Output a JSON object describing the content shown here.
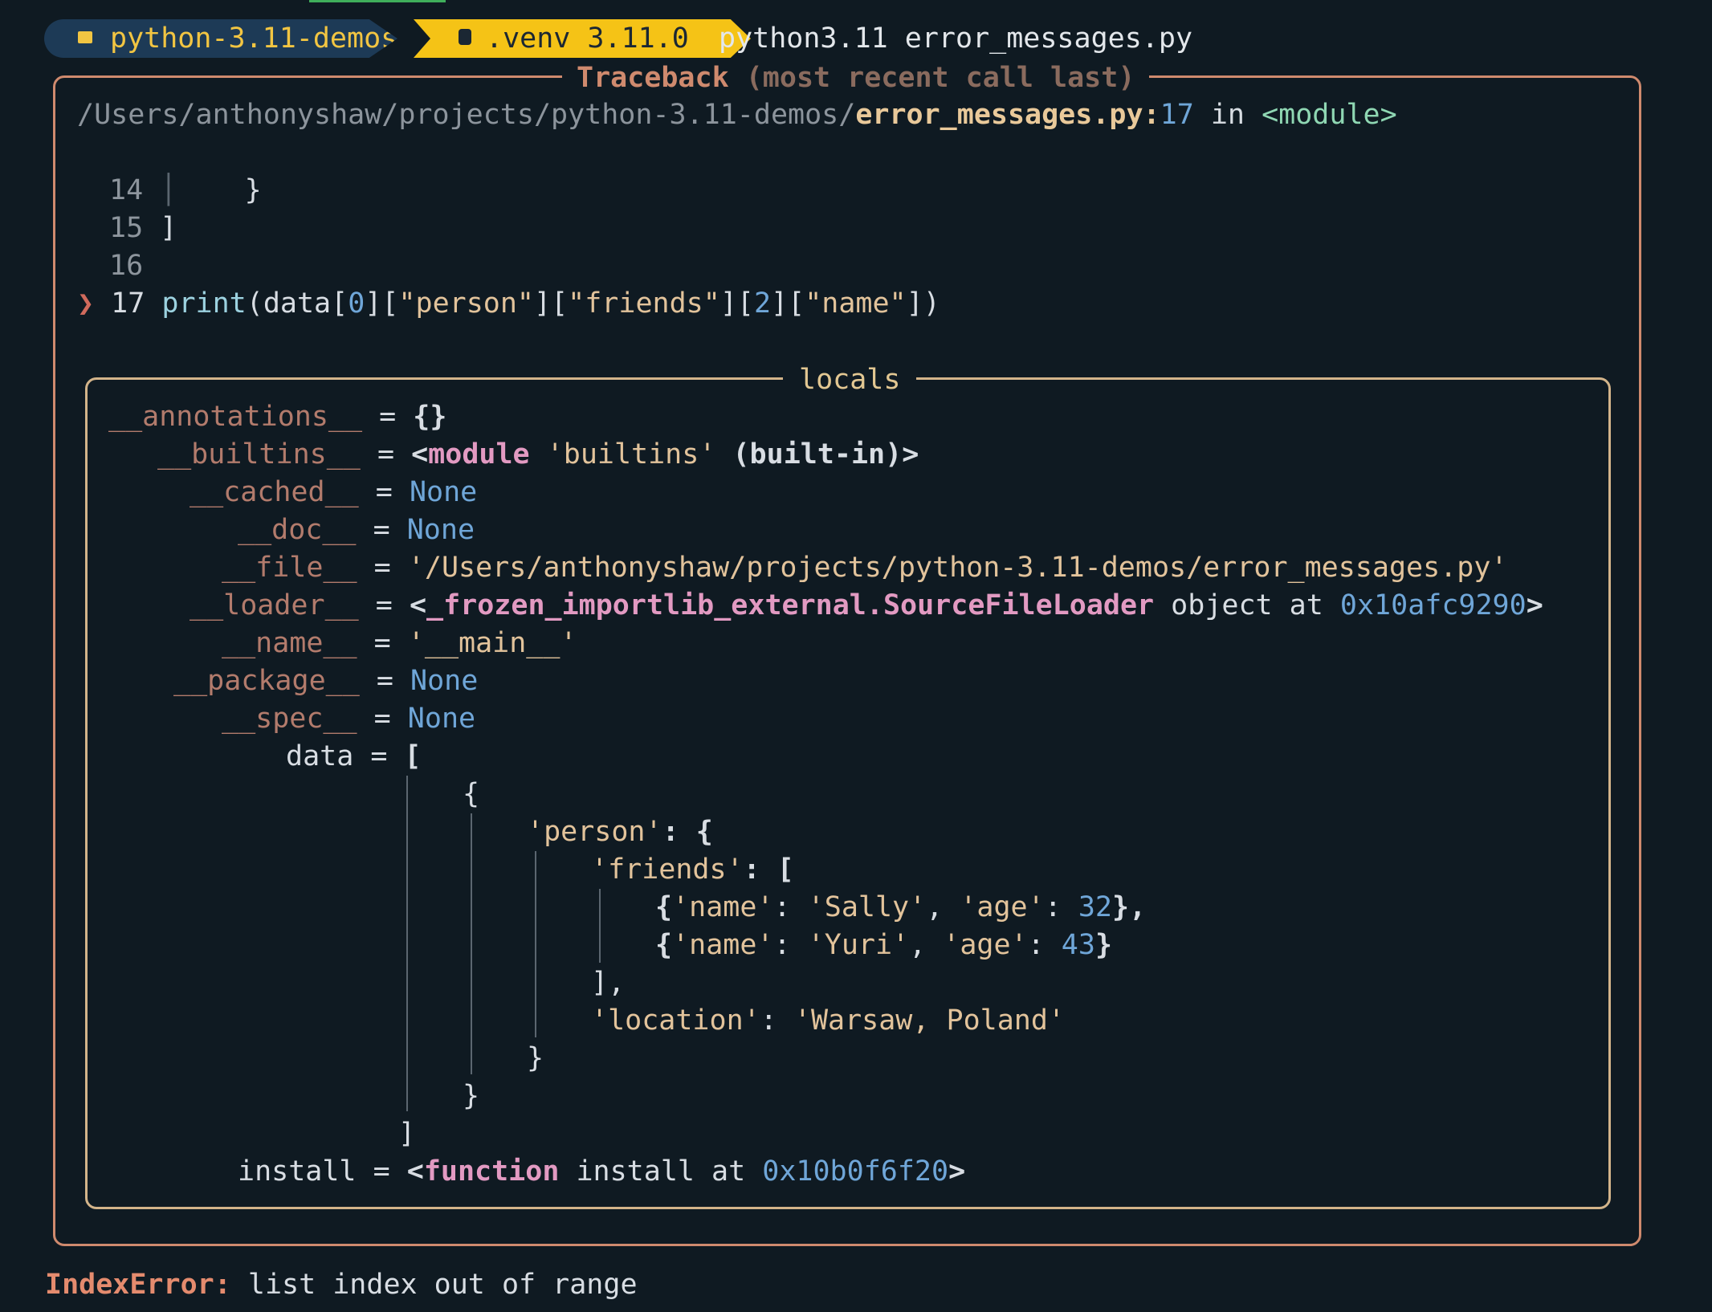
{
  "prompt": {
    "dir": "python-3.11-demos",
    "venv": ".venv 3.11.0",
    "command": "python3.11 error_messages.py"
  },
  "traceback": {
    "title": "Traceback",
    "subtitle": "(most recent call last)",
    "path_prefix": "/Users/anthonyshaw/projects/python-3.11-demos/",
    "file": "error_messages.py",
    "colon": ":",
    "line": "17",
    "in_text": " in ",
    "module": "<module>",
    "code_lines": [
      {
        "no": "14",
        "text": "    }"
      },
      {
        "no": "15",
        "text": "]"
      },
      {
        "no": "16",
        "text": ""
      }
    ],
    "current": {
      "marker": "❯",
      "no": "17",
      "func": "print",
      "parts": [
        "(data[",
        "0",
        "][",
        "\"person\"",
        "][",
        "\"friends\"",
        "][",
        "2",
        "][",
        "\"name\"",
        "])"
      ]
    }
  },
  "locals": {
    "title": "locals",
    "annotations": {
      "key": "__annotations__",
      "value": "{}"
    },
    "builtins": {
      "key": "__builtins__",
      "pre": "<",
      "kw": "module",
      "str": " 'builtins'",
      "post": " (built-in)>"
    },
    "cached": {
      "key": "__cached__",
      "value": "None"
    },
    "doc": {
      "key": "__doc__",
      "value": "None"
    },
    "file": {
      "key": "__file__",
      "value": "'/Users/anthonyshaw/projects/python-3.11-demos/error_messages.py'"
    },
    "loader": {
      "key": "__loader__",
      "pre": "<",
      "cls": "_frozen_importlib_external.SourceFileLoader",
      "mid": " object at ",
      "addr": "0x10afc9290",
      "post": ">"
    },
    "name": {
      "key": "__name__",
      "value": "'__main__'"
    },
    "package": {
      "key": "__package__",
      "value": "None"
    },
    "spec": {
      "key": "__spec__",
      "value": "None"
    },
    "data": {
      "key": "data",
      "open": "[",
      "brace_open": "{",
      "person_key": "'person'",
      "colon_brace": ": {",
      "friends_key": "'friends'",
      "colon_bracket": ": [",
      "friend1": {
        "name_key": "'name'",
        "name": "'Sally'",
        "age_key": "'age'",
        "age": "32"
      },
      "friend2": {
        "name_key": "'name'",
        "name": "'Yuri'",
        "age_key": "'age'",
        "age": "43"
      },
      "close_bracket_comma": "],",
      "location_key": "'location'",
      "location": "'Warsaw, Poland'",
      "close_inner": "}",
      "close_brace": "}",
      "close": "]"
    },
    "install": {
      "key": "install",
      "pre": "<",
      "kw": "function",
      "mid": " install at ",
      "addr": "0x10b0f6f20",
      "post": ">"
    }
  },
  "error": {
    "type": "IndexError:",
    "message": " list index out of range"
  }
}
